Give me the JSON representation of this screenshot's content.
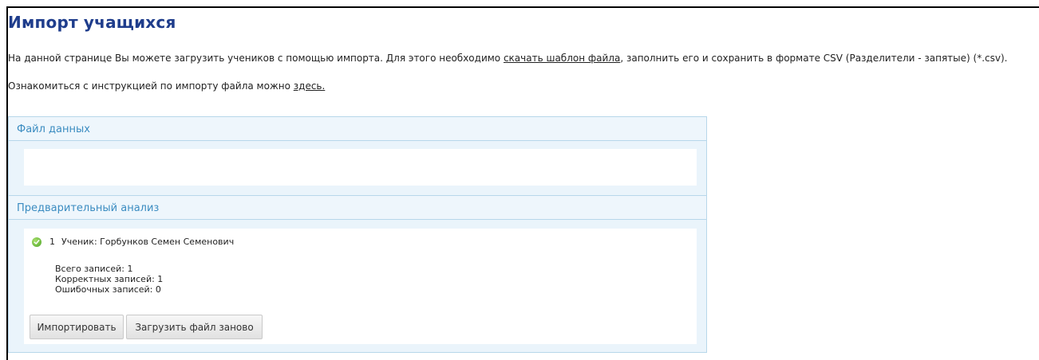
{
  "page": {
    "title": "Импорт учащихся",
    "intro_before": "На данной странице Вы можете загрузить учеников с помощью импорта. Для этого необходимо ",
    "intro_link": "скачать шаблон файла",
    "intro_after": ", заполнить его и сохранить в формате CSV (Разделители - запятые) (*.csv).",
    "instruction_before": "Ознакомиться с инструкцией по импорту файла можно ",
    "instruction_link": "здесь."
  },
  "file_section": {
    "title": "Файл данных"
  },
  "analysis_section": {
    "title": "Предварительный анализ",
    "rows": [
      {
        "num": "1",
        "text": "Ученик: Горбунков Семен Семенович",
        "status_icon": "check-ok-icon"
      }
    ],
    "stats": {
      "total": "Всего записей: 1",
      "correct": "Корректных записей: 1",
      "errors": "Ошибочных записей: 0"
    },
    "buttons": {
      "import": "Импортировать",
      "reload": "Загрузить файл заново"
    }
  },
  "colors": {
    "title": "#1f3d8c",
    "section_header": "#3b8cc1",
    "panel_border": "#b7d7ea",
    "panel_bg": "#eaf4fb",
    "ok_icon": "#4fa52a"
  }
}
